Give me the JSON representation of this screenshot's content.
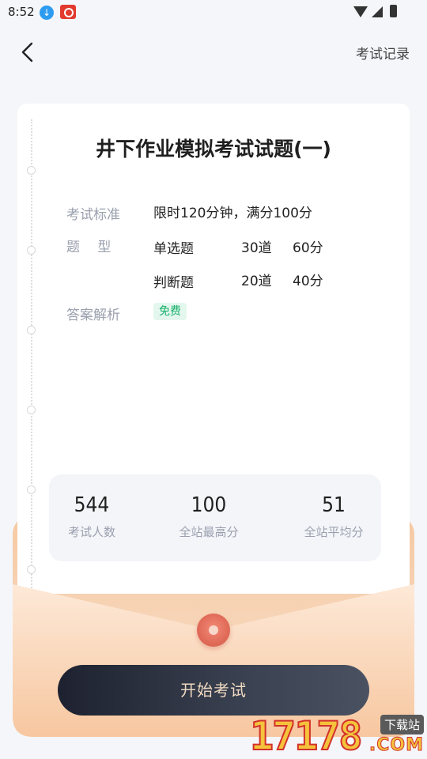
{
  "status_bar": {
    "time": "8:52",
    "icons": [
      "download-app-icon",
      "red-app-icon",
      "wifi-icon",
      "signal-icon",
      "battery-icon"
    ]
  },
  "header": {
    "back_icon": "chevron-left-icon",
    "records_label": "考试记录"
  },
  "exam": {
    "title": "井下作业模拟考试试题(一)",
    "rows": {
      "standard_label": "考试标准",
      "standard_value": "限时120分钟，满分100分",
      "type_label": "题　 型",
      "question_types": [
        {
          "name": "单选题",
          "count": "30道",
          "score": "60分"
        },
        {
          "name": "判断题",
          "count": "20道",
          "score": "40分"
        }
      ],
      "analysis_label": "答案解析",
      "analysis_badge": "免费"
    }
  },
  "stats": [
    {
      "value": "544",
      "label": "考试人数"
    },
    {
      "value": "100",
      "label": "全站最高分"
    },
    {
      "value": "51",
      "label": "全站平均分"
    }
  ],
  "start_button_label": "开始考试",
  "watermark": {
    "digits": "17178",
    "tag": "下载站",
    "domain": ".COM"
  },
  "colors": {
    "background": "#f5f6fa",
    "accent_green": "#15b06a",
    "envelope": "#f6c9a3",
    "button_dark": "#1e2230",
    "button_text": "#f0d9c2"
  }
}
